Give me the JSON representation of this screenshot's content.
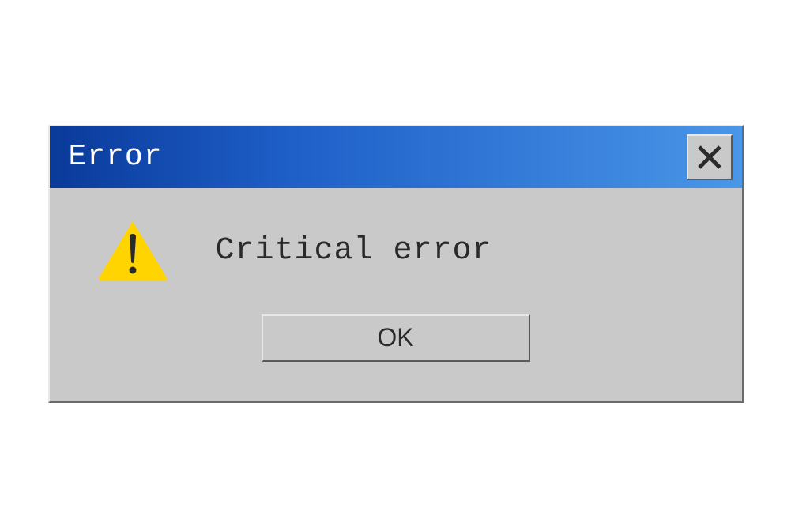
{
  "dialog": {
    "title": "Error",
    "message": "Critical error",
    "ok_label": "OK"
  }
}
